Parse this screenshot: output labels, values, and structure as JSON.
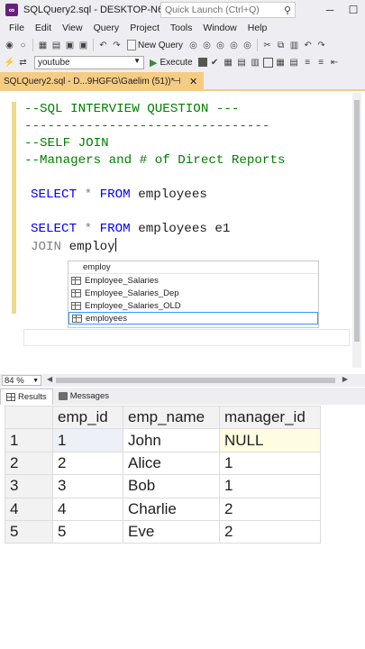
{
  "window": {
    "title": "SQLQuery2.sql - DESKTOP-N69HGF...",
    "quick_launch_placeholder": "Quick Launch (Ctrl+Q)"
  },
  "menu": [
    "File",
    "Edit",
    "View",
    "Query",
    "Project",
    "Tools",
    "Window",
    "Help"
  ],
  "toolbar": {
    "new_query_label": "New Query",
    "database_value": "youtube",
    "execute_label": "Execute"
  },
  "document_tab": {
    "label": "SQLQuery2.sql - D...9HGFG\\Gaelim (51))*"
  },
  "editor": {
    "lines": [
      "--SQL INTERVIEW QUESTION ---",
      "--------------------------------",
      "--SELF JOIN",
      "--Managers and # of Direct Reports",
      "",
      "SELECT * FROM employees",
      "",
      "SELECT * FROM employees e1",
      "JOIN employ"
    ],
    "stmt1": {
      "kw1": "SELECT",
      "star": "*",
      "kw2": "FROM",
      "table": "employees"
    },
    "stmt2": {
      "kw1": "SELECT",
      "star": "*",
      "kw2": "FROM",
      "table": "employees e1"
    },
    "stmt3": {
      "kw": "JOIN",
      "typed": "employ"
    }
  },
  "autocomplete": {
    "typed": "employ",
    "items": [
      "Employee_Salaries",
      "Employee_Salaries_Dep",
      "Employee_Salaries_OLD",
      "employees"
    ],
    "selected_index": 3
  },
  "zoom": {
    "value": "84 %"
  },
  "result_tabs": {
    "results": "Results",
    "messages": "Messages"
  },
  "results": {
    "columns": [
      "emp_id",
      "emp_name",
      "manager_id"
    ],
    "rows": [
      {
        "rn": "1",
        "emp_id": "1",
        "emp_name": "John",
        "manager_id": "NULL"
      },
      {
        "rn": "2",
        "emp_id": "2",
        "emp_name": "Alice",
        "manager_id": "1"
      },
      {
        "rn": "3",
        "emp_id": "3",
        "emp_name": "Bob",
        "manager_id": "1"
      },
      {
        "rn": "4",
        "emp_id": "4",
        "emp_name": "Charlie",
        "manager_id": "2"
      },
      {
        "rn": "5",
        "emp_id": "5",
        "emp_name": "Eve",
        "manager_id": "2"
      }
    ]
  },
  "colors": {
    "tab_accent": "#f5cc84",
    "comment": "#008000",
    "keyword": "#0000ff",
    "chrome": "#eeeef2"
  }
}
